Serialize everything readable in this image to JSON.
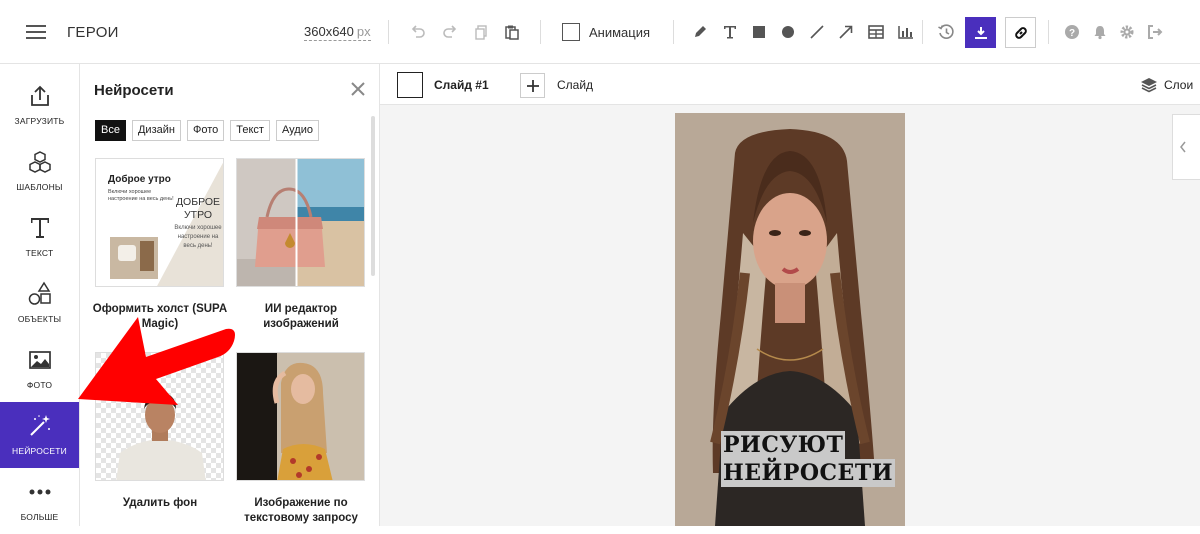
{
  "header": {
    "project_title": "ГЕРОИ",
    "canvas_size": "360x640",
    "canvas_unit": "px",
    "animation_label": "Анимация",
    "toolbar_icons": [
      "menu-icon",
      "undo-icon",
      "redo-icon",
      "copy-icon",
      "paste-icon",
      "pencil-icon",
      "text-tool-icon",
      "rectangle-tool-icon",
      "circle-tool-icon",
      "line-tool-icon",
      "arrow-tool-icon",
      "table-tool-icon",
      "chart-tool-icon",
      "history-icon",
      "download-icon",
      "link-icon",
      "help-icon",
      "bell-icon",
      "gear-icon",
      "logout-icon"
    ],
    "accent_color": "#4a2fbd"
  },
  "sidebar": {
    "items": [
      {
        "label": "ЗАГРУЗИТЬ",
        "icon": "upload-icon"
      },
      {
        "label": "ШАБЛОНЫ",
        "icon": "cubes-icon"
      },
      {
        "label": "ТЕКСТ",
        "icon": "text-icon"
      },
      {
        "label": "ОБЪЕКТЫ",
        "icon": "shapes-icon"
      },
      {
        "label": "ФОТО",
        "icon": "image-icon"
      },
      {
        "label": "НЕЙРОСЕТИ",
        "icon": "magic-wand-icon",
        "active": true
      },
      {
        "label": "БОЛЬШЕ",
        "icon": "more-dots-icon"
      }
    ]
  },
  "panel": {
    "title": "Нейросети",
    "filters": [
      "Все",
      "Дизайн",
      "Фото",
      "Текст",
      "Аудио"
    ],
    "active_filter": "Все",
    "cards": [
      {
        "title": "Оформить холст (SUPA Magic)",
        "preview_heading": "Доброе утро",
        "preview_sub": "Включи хорошее настроение на весь день!",
        "preview_heading_2": "ДОБРОЕ УТРО",
        "preview_sub_2": "Включи хорошее настроение на весь день!"
      },
      {
        "title": "ИИ редактор изображений"
      },
      {
        "title": "Удалить фон"
      },
      {
        "title": "Изображение по текстовому запросу"
      }
    ]
  },
  "stage": {
    "slide_label": "Слайд #1",
    "add_slide_label": "Слайд",
    "layers_label": "Слои",
    "caption_lines": [
      "РИСУЮТ",
      "НЕЙРОСЕТИ"
    ]
  }
}
